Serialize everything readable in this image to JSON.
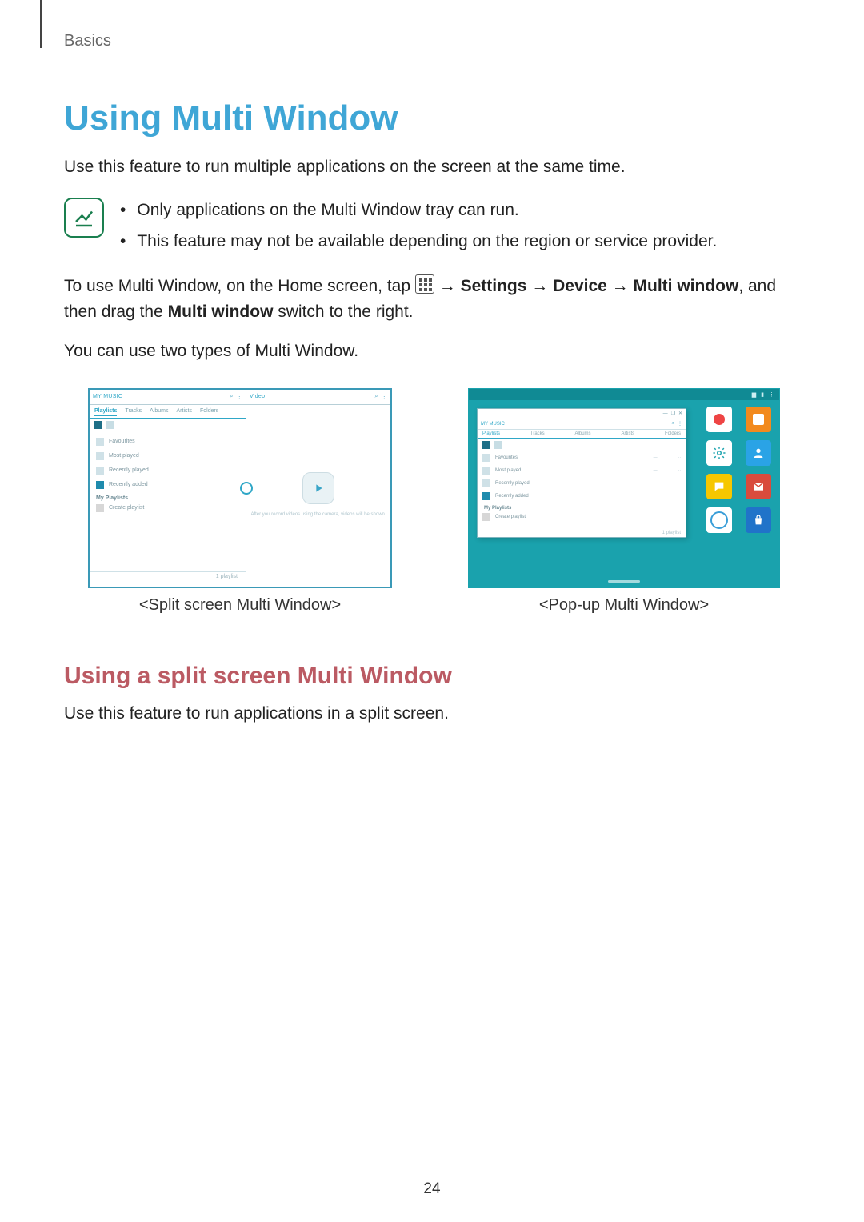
{
  "breadcrumb": "Basics",
  "title": "Using Multi Window",
  "intro": "Use this feature to run multiple applications on the screen at the same time.",
  "notes": [
    "Only applications on the Multi Window tray can run.",
    "This feature may not be available depending on the region or service provider."
  ],
  "path": {
    "pre": "To use Multi Window, on the Home screen, tap ",
    "steps": [
      "Settings",
      "Device",
      "Multi window"
    ],
    "post1": "and then drag the ",
    "switch": "Multi window",
    "post2": " switch to the right."
  },
  "types_intro": "You can use two types of Multi Window.",
  "split": {
    "left": {
      "title": "MY MUSIC",
      "tabs": [
        "Playlists",
        "Tracks",
        "Albums",
        "Artists",
        "Folders"
      ],
      "items": [
        "Favourites",
        "Most played",
        "Recently played",
        "Recently added"
      ],
      "section": "My Playlists",
      "items2": [
        "Create playlist"
      ],
      "footer": "1 playlist"
    },
    "right": {
      "title": "Video",
      "hint": "After you record videos using the camera, videos will be shown."
    }
  },
  "popup": {
    "title": "MY MUSIC",
    "tabs": [
      "Playlists",
      "Tracks",
      "Albums",
      "Artists",
      "Folders"
    ],
    "items": [
      "Favourites",
      "Most played",
      "Recently played",
      "Recently added"
    ],
    "section": "My Playlists",
    "items2": [
      "Create playlist"
    ],
    "footer": "1 playlist"
  },
  "captions": {
    "split": "<Split screen Multi Window>",
    "popup": "<Pop-up Multi Window>"
  },
  "section": {
    "title": "Using a split screen Multi Window",
    "text": "Use this feature to run applications in a split screen."
  },
  "page_number": "24"
}
